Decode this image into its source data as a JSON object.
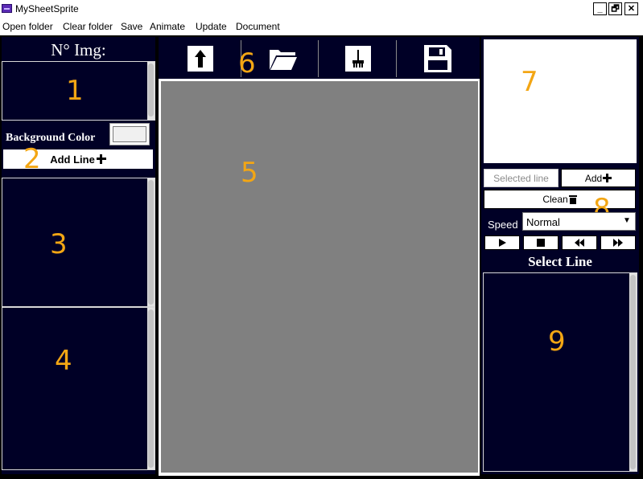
{
  "window": {
    "title": "MySheetSprite",
    "controls": {
      "minimize": "_",
      "restore": "🗗",
      "close": "✕"
    }
  },
  "menu": [
    "Open folder",
    "Clear folder",
    "Save",
    "Animate",
    "Update",
    "Document"
  ],
  "left_panel": {
    "img_count_label": "N° Img:",
    "background_color_label": "Background Color",
    "background_color_value": "#f0f0f0",
    "add_line_label": "Add Line",
    "add_line_icon": "plus-icon"
  },
  "toolbar": {
    "icons": [
      "upload-icon",
      "folder-icon",
      "brush-icon",
      "save-icon"
    ]
  },
  "right_panel": {
    "selected_line_label": "Selected line",
    "add_label": "Add",
    "clean_label": "Clean",
    "speed_label": "Speed",
    "speed_value": "Normal",
    "playback_icons": [
      "play-icon",
      "stop-icon",
      "rewind-icon",
      "fast-forward-icon"
    ],
    "select_line_label": "Select Line"
  },
  "annotations": [
    "1",
    "2",
    "3",
    "4",
    "5",
    "6",
    "7",
    "8",
    "9"
  ],
  "colors": {
    "panel_navy": "#000026",
    "canvas_gray": "#808080",
    "annotation_orange": "#f3a614"
  }
}
